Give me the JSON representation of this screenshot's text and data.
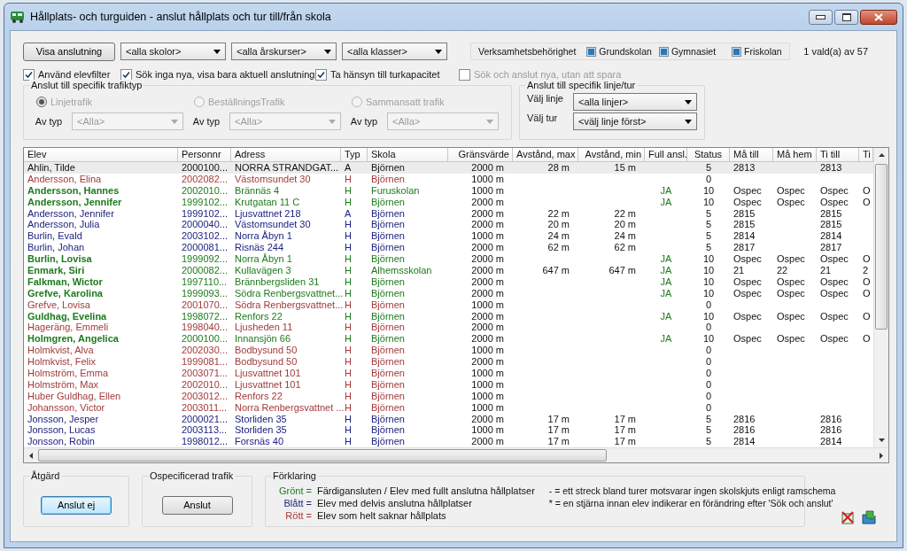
{
  "window": {
    "title": "Hållplats- och turguiden - anslut hållplats och tur till/från skola"
  },
  "show_button": "Visa anslutning",
  "filters": [
    {
      "value": "<alla skolor>"
    },
    {
      "value": "<alla årskurser>"
    },
    {
      "value": "<alla klasser>"
    }
  ],
  "permissions": {
    "label": "Verksamhetsbehörighet",
    "items": [
      {
        "label": "Grundskolan",
        "checked": true
      },
      {
        "label": "Gymnasiet",
        "checked": true
      },
      {
        "label": "Friskolan",
        "checked": true
      }
    ]
  },
  "selection_count": "1 vald(a) av 57",
  "options": [
    {
      "label": "Använd elevfilter",
      "checked": true,
      "disabled": false
    },
    {
      "label": "Sök inga nya, visa bara aktuell anslutning",
      "checked": true,
      "disabled": false
    },
    {
      "label": "Ta hänsyn till turkapacitet",
      "checked": true,
      "disabled": false
    },
    {
      "label": "Sök och anslut nya, utan att spara",
      "checked": false,
      "disabled": true
    }
  ],
  "traffic_type": {
    "title": "Anslut till specifik trafiktyp",
    "types": [
      {
        "label": "Linjetrafik",
        "selected": true,
        "disabled": true,
        "type_label": "Av typ",
        "type_value": "<Alla>"
      },
      {
        "label": "BeställningsTrafik",
        "selected": false,
        "disabled": true,
        "type_label": "Av typ",
        "type_value": "<Alla>"
      },
      {
        "label": "Sammansatt trafik",
        "selected": false,
        "disabled": true,
        "type_label": "Av typ",
        "type_value": "<Alla>"
      }
    ]
  },
  "line_trip": {
    "title": "Anslut till specifik linje/tur",
    "fields": [
      {
        "label": "Välj linje",
        "value": "<alla linjer>"
      },
      {
        "label": "Välj tur",
        "value": "<välj linje först>"
      }
    ]
  },
  "table": {
    "columns": [
      "Elev",
      "Personnr",
      "Adress",
      "Typ",
      "Skola",
      "Gränsvärde",
      "Avstånd, max",
      "Avstånd, min",
      "Full ansl.",
      "Status",
      "Må till",
      "Må hem",
      "Ti till",
      "Ti"
    ],
    "rows": [
      {
        "kind": "partial",
        "selected": true,
        "cells": [
          "Ahlin, Tilde",
          "2000100...",
          "NORRA STRANDGAT...",
          "A",
          "Björnen",
          "2000 m",
          "28 m",
          "15 m",
          null,
          "5",
          "2813",
          null,
          "2813",
          null
        ]
      },
      {
        "kind": "none",
        "selected": false,
        "cells": [
          "Andersson, Elina",
          "2002082...",
          "Västomsundet 30",
          "H",
          "Björnen",
          "1000 m",
          null,
          null,
          null,
          "0",
          null,
          null,
          null,
          null
        ]
      },
      {
        "kind": "full",
        "selected": false,
        "cells": [
          "Andersson, Hannes",
          "2002010...",
          "Brännäs 4",
          "H",
          "Furuskolan",
          "1000 m",
          null,
          null,
          "JA",
          "10",
          "Ospec",
          "Ospec",
          "Ospec",
          "O"
        ]
      },
      {
        "kind": "full",
        "selected": false,
        "cells": [
          "Andersson, Jennifer",
          "1999102...",
          "Krutgatan 11 C",
          "H",
          "Björnen",
          "2000 m",
          null,
          null,
          "JA",
          "10",
          "Ospec",
          "Ospec",
          "Ospec",
          "O"
        ]
      },
      {
        "kind": "partial",
        "selected": false,
        "cells": [
          "Andersson, Jennifer",
          "1999102...",
          "Ljusvattnet 218",
          "A",
          "Björnen",
          "2000 m",
          "22 m",
          "22 m",
          null,
          "5",
          "2815",
          null,
          "2815",
          null
        ]
      },
      {
        "kind": "partial",
        "selected": false,
        "cells": [
          "Andersson, Julia",
          "2000040...",
          "Västomsundet 30",
          "H",
          "Björnen",
          "2000 m",
          "20 m",
          "20 m",
          null,
          "5",
          "2815",
          null,
          "2815",
          null
        ]
      },
      {
        "kind": "partial",
        "selected": false,
        "cells": [
          "Burlin, Evald",
          "2003102...",
          "Norra Åbyn 1",
          "H",
          "Björnen",
          "1000 m",
          "24 m",
          "24 m",
          null,
          "5",
          "2814",
          null,
          "2814",
          null
        ]
      },
      {
        "kind": "partial",
        "selected": false,
        "cells": [
          "Burlin, Johan",
          "2000081...",
          "Risnäs 244",
          "H",
          "Björnen",
          "2000 m",
          "62 m",
          "62 m",
          null,
          "5",
          "2817",
          null,
          "2817",
          null
        ]
      },
      {
        "kind": "full",
        "selected": false,
        "cells": [
          "Burlin, Lovisa",
          "1999092...",
          "Norra Åbyn 1",
          "H",
          "Björnen",
          "2000 m",
          null,
          null,
          "JA",
          "10",
          "Ospec",
          "Ospec",
          "Ospec",
          "O"
        ]
      },
      {
        "kind": "full",
        "selected": false,
        "cells": [
          "Enmark, Siri",
          "2000082...",
          "Kullavägen 3",
          "H",
          "Alhemsskolan",
          "2000 m",
          "647 m",
          "647 m",
          "JA",
          "10",
          "21",
          "22",
          "21",
          "2"
        ]
      },
      {
        "kind": "full",
        "selected": false,
        "cells": [
          "Falkman, Wictor",
          "1997110...",
          "Brännbergsliden 31",
          "H",
          "Björnen",
          "2000 m",
          null,
          null,
          "JA",
          "10",
          "Ospec",
          "Ospec",
          "Ospec",
          "O"
        ]
      },
      {
        "kind": "full",
        "selected": false,
        "cells": [
          "Grefve, Karolina",
          "1999093...",
          "Södra Renbergsvattnet...",
          "H",
          "Björnen",
          "2000 m",
          null,
          null,
          "JA",
          "10",
          "Ospec",
          "Ospec",
          "Ospec",
          "O"
        ]
      },
      {
        "kind": "none",
        "selected": false,
        "cells": [
          "Grefve, Lovisa",
          "2001070...",
          "Södra Renbergsvattnet...",
          "H",
          "Björnen",
          "1000 m",
          null,
          null,
          null,
          "0",
          null,
          null,
          null,
          null
        ]
      },
      {
        "kind": "full",
        "selected": false,
        "cells": [
          "Guldhag, Evelina",
          "1998072...",
          "Renfors 22",
          "H",
          "Björnen",
          "2000 m",
          null,
          null,
          "JA",
          "10",
          "Ospec",
          "Ospec",
          "Ospec",
          "O"
        ]
      },
      {
        "kind": "none",
        "selected": false,
        "cells": [
          "Hageräng, Emmeli",
          "1998040...",
          "Ljusheden 11",
          "H",
          "Björnen",
          "2000 m",
          null,
          null,
          null,
          "0",
          null,
          null,
          null,
          null
        ]
      },
      {
        "kind": "full",
        "selected": false,
        "cells": [
          "Holmgren, Angelica",
          "2000100...",
          "Innansjön 66",
          "H",
          "Björnen",
          "2000 m",
          null,
          null,
          "JA",
          "10",
          "Ospec",
          "Ospec",
          "Ospec",
          "O"
        ]
      },
      {
        "kind": "none",
        "selected": false,
        "cells": [
          "Holmkvist, Alva",
          "2002030...",
          "Bodbysund 50",
          "H",
          "Björnen",
          "1000 m",
          null,
          null,
          null,
          "0",
          null,
          null,
          null,
          null
        ]
      },
      {
        "kind": "none",
        "selected": false,
        "cells": [
          "Holmkvist, Felix",
          "1999081...",
          "Bodbysund 50",
          "H",
          "Björnen",
          "2000 m",
          null,
          null,
          null,
          "0",
          null,
          null,
          null,
          null
        ]
      },
      {
        "kind": "none",
        "selected": false,
        "cells": [
          "Holmström, Emma",
          "2003071...",
          "Ljusvattnet 101",
          "H",
          "Björnen",
          "1000 m",
          null,
          null,
          null,
          "0",
          null,
          null,
          null,
          null
        ]
      },
      {
        "kind": "none",
        "selected": false,
        "cells": [
          "Holmström, Max",
          "2002010...",
          "Ljusvattnet 101",
          "H",
          "Björnen",
          "1000 m",
          null,
          null,
          null,
          "0",
          null,
          null,
          null,
          null
        ]
      },
      {
        "kind": "none",
        "selected": false,
        "cells": [
          "Huber Guldhag, Ellen",
          "2003012...",
          "Renfors 22",
          "H",
          "Björnen",
          "1000 m",
          null,
          null,
          null,
          "0",
          null,
          null,
          null,
          null
        ]
      },
      {
        "kind": "none",
        "selected": false,
        "cells": [
          "Johansson, Victor",
          "2003011...",
          "Norra Renbergsvattnet ...",
          "H",
          "Björnen",
          "1000 m",
          null,
          null,
          null,
          "0",
          null,
          null,
          null,
          null
        ]
      },
      {
        "kind": "partial",
        "selected": false,
        "cells": [
          "Jonsson, Jesper",
          "2000021...",
          "Storliden 35",
          "H",
          "Björnen",
          "2000 m",
          "17 m",
          "17 m",
          null,
          "5",
          "2816",
          null,
          "2816",
          null
        ]
      },
      {
        "kind": "partial",
        "selected": false,
        "cells": [
          "Jonsson, Lucas",
          "2003113...",
          "Storliden 35",
          "H",
          "Björnen",
          "1000 m",
          "17 m",
          "17 m",
          null,
          "5",
          "2816",
          null,
          "2816",
          null
        ]
      },
      {
        "kind": "partial",
        "selected": false,
        "cells": [
          "Jonsson, Robin",
          "1998012...",
          "Forsnäs 40",
          "H",
          "Björnen",
          "2000 m",
          "17 m",
          "17 m",
          null,
          "5",
          "2814",
          null,
          "2814",
          null
        ]
      }
    ]
  },
  "action": {
    "title": "Åtgärd",
    "button": "Anslut ej"
  },
  "unspecified": {
    "title": "Ospecificerad trafik",
    "button": "Anslut"
  },
  "legend": {
    "title": "Förklaring",
    "items": [
      {
        "key": "Grönt =",
        "text": "Färdigansluten / Elev med fullt anslutna hållplatser",
        "color": "#1d7a1d"
      },
      {
        "key": "Blått =",
        "text": "Elev med delvis anslutna hållplatser",
        "color": "#1c2380"
      },
      {
        "key": "Rött =",
        "text": "Elev som helt saknar hållplats",
        "color": "#a33a3a"
      }
    ],
    "notes": [
      "- = ett streck bland turer motsvarar ingen skolskjuts enligt ramschema",
      "* = en stjärna innan elev indikerar en förändring efter 'Sök och anslut'"
    ]
  }
}
